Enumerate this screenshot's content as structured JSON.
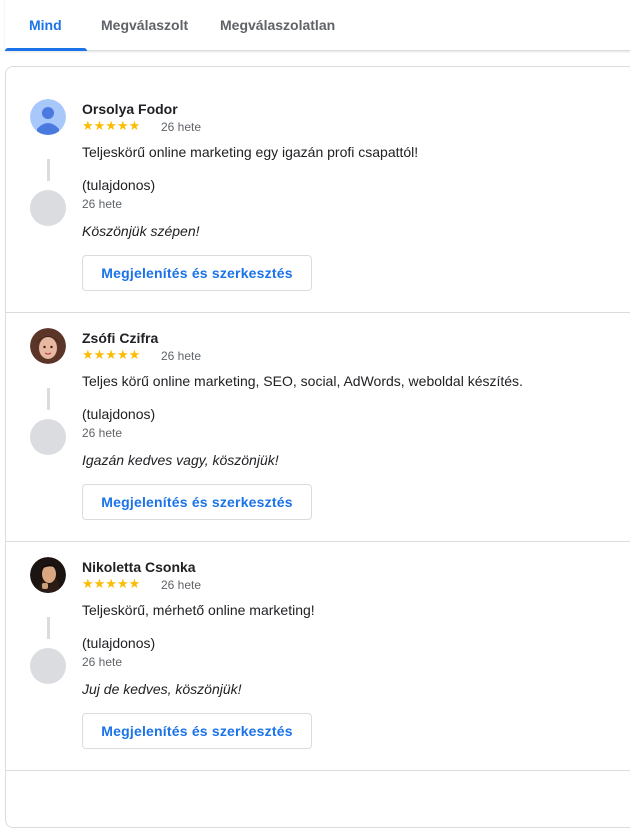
{
  "tabs": [
    {
      "label": "Mind",
      "active": true
    },
    {
      "label": "Megválaszolt",
      "active": false
    },
    {
      "label": "Megválaszolatlan",
      "active": false
    }
  ],
  "colors": {
    "accent": "#1a73e8",
    "star": "#fbbc04",
    "divider": "#dadce0"
  },
  "reviews": [
    {
      "author": "Orsolya Fodor",
      "rating_text": "★★★★★",
      "rating": 5,
      "time": "26 hete",
      "text": "Teljeskörű online marketing egy igazán profi csapattól!",
      "owner_label": "(tulajdonos)",
      "owner_time": "26 hete",
      "reply": "Köszönjük szépen!",
      "button": "Megjelenítés és szerkesztés",
      "avatar_icon": "default-person-icon"
    },
    {
      "author": "Zsófi Czifra",
      "rating_text": "★★★★★",
      "rating": 5,
      "time": "26 hete",
      "text": "Teljes körű online marketing, SEO, social, AdWords, weboldal készítés.",
      "owner_label": "(tulajdonos)",
      "owner_time": "26 hete",
      "reply": "Igazán kedves vagy, köszönjük!",
      "button": "Megjelenítés és szerkesztés",
      "avatar_icon": "profile-photo"
    },
    {
      "author": "Nikoletta Csonka",
      "rating_text": "★★★★★",
      "rating": 5,
      "time": "26 hete",
      "text": "Teljeskörű, mérhető online marketing!",
      "owner_label": "(tulajdonos)",
      "owner_time": "26 hete",
      "reply": "Juj de kedves, köszönjük!",
      "button": "Megjelenítés és szerkesztés",
      "avatar_icon": "profile-photo"
    }
  ]
}
